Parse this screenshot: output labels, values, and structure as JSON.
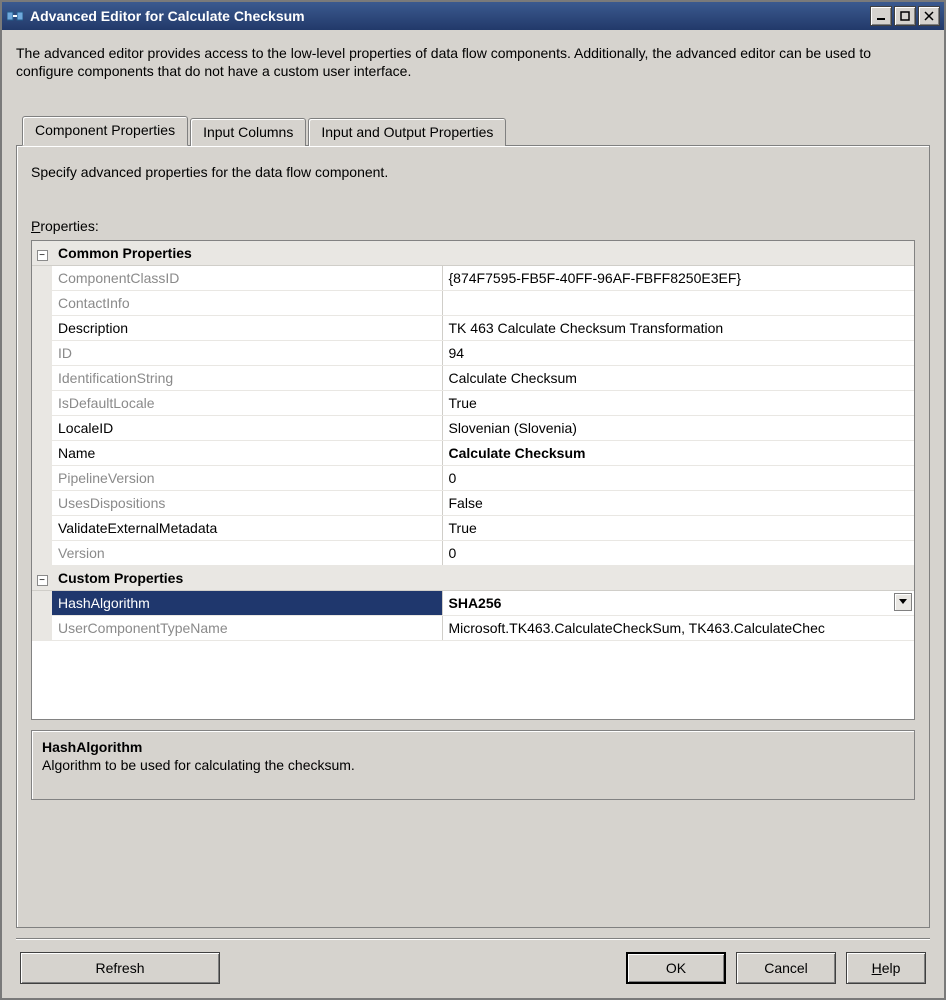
{
  "window": {
    "title": "Advanced Editor for Calculate Checksum"
  },
  "intro": "The advanced editor provides access to the low-level properties of data flow components. Additionally, the advanced editor can be used to configure components that do not have a custom user interface.",
  "tabs": {
    "t0": "Component Properties",
    "t1": "Input Columns",
    "t2": "Input and Output Properties"
  },
  "tabbody": {
    "instruction": "Specify advanced properties for the data flow component.",
    "label": "Properties:"
  },
  "catCommon": "Common Properties",
  "catCustom": "Custom Properties",
  "rows": {
    "ComponentClassID": {
      "n": "ComponentClassID",
      "v": "{874F7595-FB5F-40FF-96AF-FBFF8250E3EF}"
    },
    "ContactInfo": {
      "n": "ContactInfo",
      "v": ""
    },
    "Description": {
      "n": "Description",
      "v": "TK 463 Calculate Checksum Transformation"
    },
    "ID": {
      "n": "ID",
      "v": "94"
    },
    "IdentificationString": {
      "n": "IdentificationString",
      "v": "Calculate Checksum"
    },
    "IsDefaultLocale": {
      "n": "IsDefaultLocale",
      "v": "True"
    },
    "LocaleID": {
      "n": "LocaleID",
      "v": "Slovenian (Slovenia)"
    },
    "Name": {
      "n": "Name",
      "v": "Calculate Checksum"
    },
    "PipelineVersion": {
      "n": "PipelineVersion",
      "v": "0"
    },
    "UsesDispositions": {
      "n": "UsesDispositions",
      "v": "False"
    },
    "ValidateExternalMetadata": {
      "n": "ValidateExternalMetadata",
      "v": "True"
    },
    "Version": {
      "n": "Version",
      "v": "0"
    },
    "HashAlgorithm": {
      "n": "HashAlgorithm",
      "v": "SHA256"
    },
    "UserComponentTypeName": {
      "n": "UserComponentTypeName",
      "v": "Microsoft.TK463.CalculateCheckSum, TK463.CalculateChec"
    }
  },
  "desc": {
    "title": "HashAlgorithm",
    "text": "Algorithm to be used for calculating the checksum."
  },
  "buttons": {
    "refresh": "Refresh",
    "ok": "OK",
    "cancel": "Cancel",
    "help": "Help"
  }
}
